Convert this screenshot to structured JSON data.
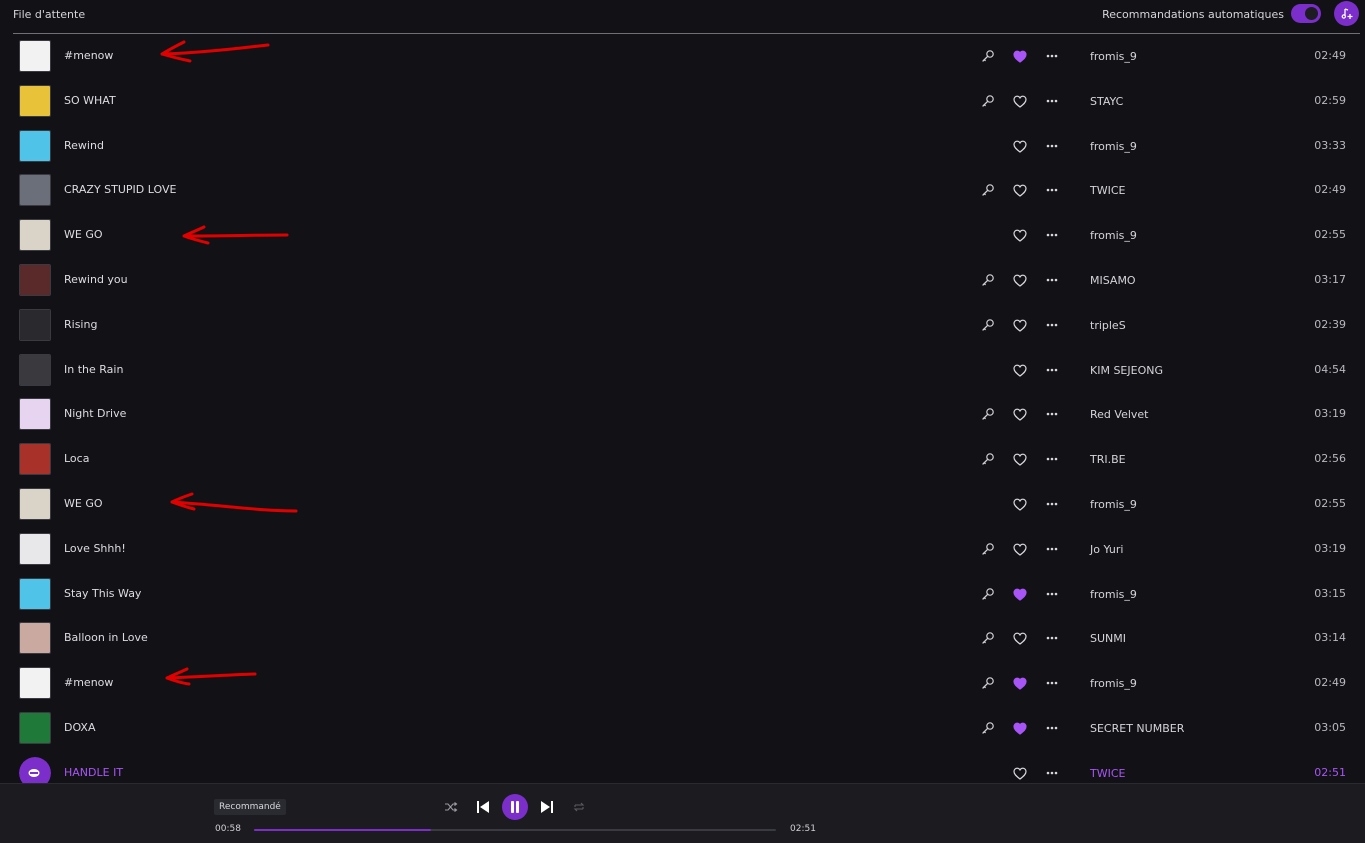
{
  "header": {
    "title": "File d'attente",
    "auto_reco_label": "Recommandations automatiques",
    "auto_reco_enabled": true
  },
  "tracks": [
    {
      "title": "#menow",
      "artist": "fromis_9",
      "duration": "02:49",
      "lyrics": true,
      "liked": true,
      "cover": "#f2f2f2"
    },
    {
      "title": "SO WHAT",
      "artist": "STAYC",
      "duration": "02:59",
      "lyrics": true,
      "liked": false,
      "cover": "#e8c33a"
    },
    {
      "title": "Rewind",
      "artist": "fromis_9",
      "duration": "03:33",
      "lyrics": false,
      "liked": false,
      "cover": "#4fc3e8"
    },
    {
      "title": "CRAZY STUPID LOVE",
      "artist": "TWICE",
      "duration": "02:49",
      "lyrics": true,
      "liked": false,
      "cover": "#6b6f7a"
    },
    {
      "title": "WE GO",
      "artist": "fromis_9",
      "duration": "02:55",
      "lyrics": false,
      "liked": false,
      "cover": "#d9d4c7"
    },
    {
      "title": "Rewind you",
      "artist": "MISAMO",
      "duration": "03:17",
      "lyrics": true,
      "liked": false,
      "cover": "#5a2a2a"
    },
    {
      "title": "Rising",
      "artist": "tripleS",
      "duration": "02:39",
      "lyrics": true,
      "liked": false,
      "cover": "#2a2a2e"
    },
    {
      "title": "In the Rain",
      "artist": "KIM SEJEONG",
      "duration": "04:54",
      "lyrics": false,
      "liked": false,
      "cover": "#3a3a3e"
    },
    {
      "title": "Night Drive",
      "artist": "Red Velvet",
      "duration": "03:19",
      "lyrics": true,
      "liked": false,
      "cover": "#e6d4f0"
    },
    {
      "title": "Loca",
      "artist": "TRI.BE",
      "duration": "02:56",
      "lyrics": true,
      "liked": false,
      "cover": "#a8322a"
    },
    {
      "title": "WE GO",
      "artist": "fromis_9",
      "duration": "02:55",
      "lyrics": false,
      "liked": false,
      "cover": "#d9d4c7"
    },
    {
      "title": "Love Shhh!",
      "artist": "Jo Yuri",
      "duration": "03:19",
      "lyrics": true,
      "liked": false,
      "cover": "#e8e8ea"
    },
    {
      "title": "Stay This Way",
      "artist": "fromis_9",
      "duration": "03:15",
      "lyrics": true,
      "liked": true,
      "cover": "#4fc3e8"
    },
    {
      "title": "Balloon in Love",
      "artist": "SUNMI",
      "duration": "03:14",
      "lyrics": true,
      "liked": false,
      "cover": "#c9a9a0"
    },
    {
      "title": "#menow",
      "artist": "fromis_9",
      "duration": "02:49",
      "lyrics": true,
      "liked": true,
      "cover": "#f2f2f2"
    },
    {
      "title": "DOXA",
      "artist": "SECRET NUMBER",
      "duration": "03:05",
      "lyrics": true,
      "liked": true,
      "cover": "#1f7a3a"
    },
    {
      "title": "HANDLE IT",
      "artist": "TWICE",
      "duration": "02:51",
      "lyrics": false,
      "liked": false,
      "cover": "#7b2ec9",
      "current": true
    }
  ],
  "player": {
    "badge": "Recommandé",
    "elapsed": "00:58",
    "total": "02:51",
    "progress_fraction": 0.34
  },
  "colors": {
    "accent": "#7b2ec9",
    "accent_text": "#a855f7",
    "liked_heart": "#a855f7",
    "annotation_arrow": "#e00000"
  },
  "icons": [
    "microphone-icon",
    "heart-icon",
    "more-dots-icon",
    "shuffle-icon",
    "previous-icon",
    "pause-icon",
    "next-icon",
    "repeat-icon",
    "add-to-queue-icon"
  ]
}
